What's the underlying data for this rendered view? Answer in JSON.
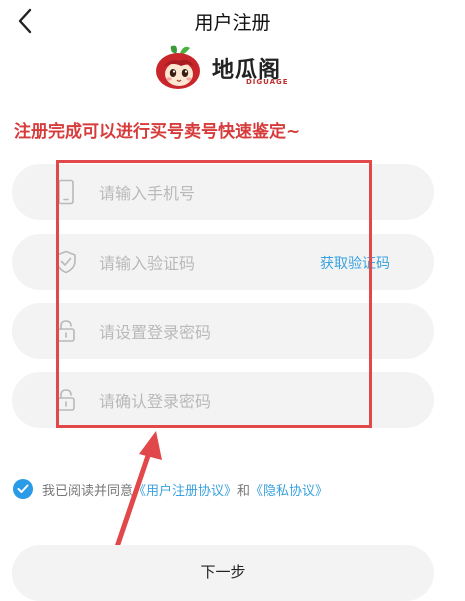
{
  "header": {
    "title": "用户注册",
    "back_icon": "chevron-left-icon"
  },
  "logo": {
    "name": "地瓜阁",
    "sub": "DIGUAGE"
  },
  "tagline": "注册完成可以进行买号卖号快速鉴定~",
  "form": {
    "phone": {
      "placeholder": "请输入手机号",
      "icon": "phone-icon",
      "value": ""
    },
    "code": {
      "placeholder": "请输入验证码",
      "icon": "shield-icon",
      "value": "",
      "get_code_label": "获取验证码"
    },
    "password": {
      "placeholder": "请设置登录密码",
      "icon": "lock-icon",
      "value": ""
    },
    "confirm_password": {
      "placeholder": "请确认登录密码",
      "icon": "lock-icon",
      "value": ""
    }
  },
  "agreement": {
    "checked": true,
    "prefix": "我已阅读并同意",
    "user_agreement": "《用户注册协议》",
    "and": "和",
    "privacy": "《隐私协议》"
  },
  "next_button": "下一步",
  "colors": {
    "accent": "#3aa2e0",
    "tagline": "#d63c3c",
    "annotation": "#e0484a",
    "field_bg": "#f3f3f3"
  }
}
